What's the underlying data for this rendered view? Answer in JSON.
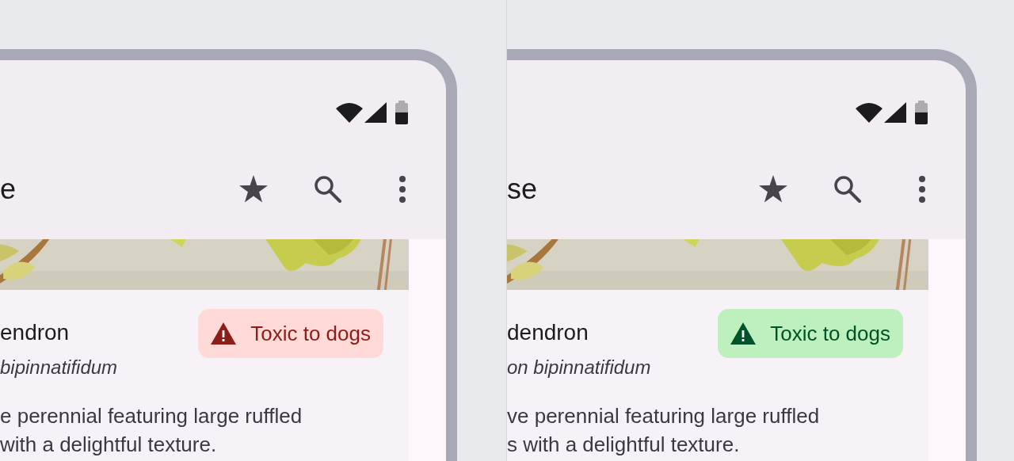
{
  "panels": [
    {
      "app_bar": {
        "title": "e"
      },
      "plant": {
        "name": "endron",
        "scientific_name": "bipinnatifidum",
        "description_lines": [
          "e perennial featuring large ruffled",
          "with a delightful texture."
        ]
      },
      "badge": {
        "label": "Toxic to dogs",
        "kind": "error"
      }
    },
    {
      "app_bar": {
        "title": "se"
      },
      "plant": {
        "name": "dendron",
        "scientific_name": "on bipinnatifidum",
        "description_lines": [
          "ve perennial featuring large ruffled",
          "s with a delightful texture."
        ]
      },
      "badge": {
        "label": "Toxic to dogs",
        "kind": "success"
      }
    }
  ]
}
